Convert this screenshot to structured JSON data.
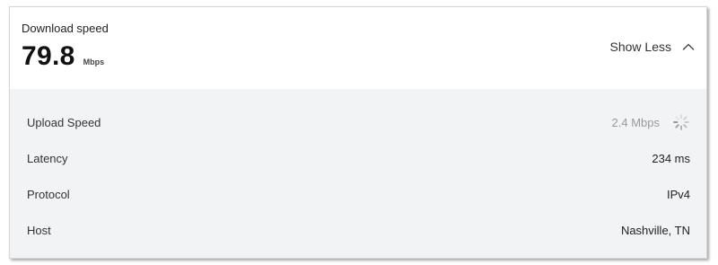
{
  "summary": {
    "title": "Download speed",
    "value": "79.8",
    "unit": "Mbps",
    "toggle_label": "Show Less",
    "toggle_icon": "chevron-up-icon"
  },
  "details": {
    "rows": [
      {
        "label": "Upload Speed",
        "value": "2.4 Mbps",
        "status": "loading"
      },
      {
        "label": "Latency",
        "value": "234 ms"
      },
      {
        "label": "Protocol",
        "value": "IPv4"
      },
      {
        "label": "Host",
        "value": "Nashville, TN"
      }
    ]
  },
  "colors": {
    "details_background": "#f2f3f4",
    "pending_text": "#9a9a9a"
  }
}
